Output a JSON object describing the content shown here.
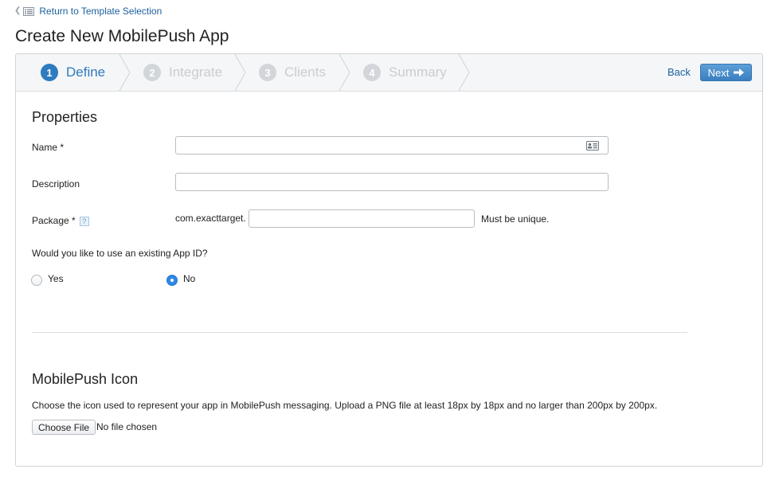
{
  "nav": {
    "back_link_label": "Return to Template Selection"
  },
  "page": {
    "title": "Create New MobilePush App"
  },
  "wizard": {
    "steps": [
      {
        "number": "1",
        "label": "Define",
        "state": "active"
      },
      {
        "number": "2",
        "label": "Integrate",
        "state": "inactive"
      },
      {
        "number": "3",
        "label": "Clients",
        "state": "inactive"
      },
      {
        "number": "4",
        "label": "Summary",
        "state": "inactive"
      }
    ],
    "back_label": "Back",
    "next_label": "Next"
  },
  "properties": {
    "title": "Properties",
    "name_label": "Name *",
    "name_value": "",
    "description_label": "Description",
    "description_value": "",
    "package_label": "Package *",
    "package_help": "?",
    "package_prefix": "com.exacttarget.",
    "package_value": "",
    "package_hint": "Must be unique.",
    "app_id_question": "Would you like to use an existing App ID?",
    "yes_label": "Yes",
    "no_label": "No",
    "selected": "No"
  },
  "icon_section": {
    "title": "MobilePush Icon",
    "instructions": "Choose the icon used to represent your app in MobilePush messaging. Upload a PNG file at least 18px by 18px and no larger than 200px by 200px.",
    "choose_file_label": "Choose File",
    "file_status": "No file chosen"
  },
  "colors": {
    "accent": "#2f7bbf",
    "link": "#1b5f9e",
    "radio_selected": "#2f87e6"
  }
}
